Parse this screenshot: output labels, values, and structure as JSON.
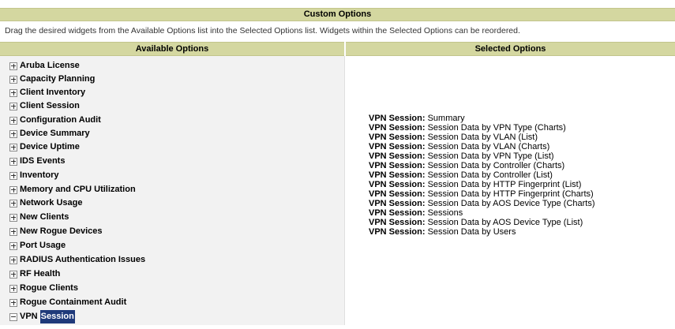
{
  "header": {
    "title": "Custom Options"
  },
  "instructions": "Drag the desired widgets from the Available Options list into the Selected Options list. Widgets within the Selected Options can be reordered.",
  "available": {
    "header": "Available Options",
    "items": [
      {
        "label": "Aruba License",
        "state": "collapsed"
      },
      {
        "label": "Capacity Planning",
        "state": "collapsed"
      },
      {
        "label": "Client Inventory",
        "state": "collapsed"
      },
      {
        "label": "Client Session",
        "state": "collapsed"
      },
      {
        "label": "Configuration Audit",
        "state": "collapsed"
      },
      {
        "label": "Device Summary",
        "state": "collapsed"
      },
      {
        "label": "Device Uptime",
        "state": "collapsed"
      },
      {
        "label": "IDS Events",
        "state": "collapsed"
      },
      {
        "label": "Inventory",
        "state": "collapsed"
      },
      {
        "label": "Memory and CPU Utilization",
        "state": "collapsed"
      },
      {
        "label": "Network Usage",
        "state": "collapsed"
      },
      {
        "label": "New Clients",
        "state": "collapsed"
      },
      {
        "label": "New Rogue Devices",
        "state": "collapsed"
      },
      {
        "label": "Port Usage",
        "state": "collapsed"
      },
      {
        "label": "RADIUS Authentication Issues",
        "state": "collapsed"
      },
      {
        "label": "RF Health",
        "state": "collapsed"
      },
      {
        "label": "Rogue Clients",
        "state": "collapsed"
      },
      {
        "label": "Rogue Containment Audit",
        "state": "collapsed"
      },
      {
        "label_prefix": "VPN",
        "label_selected": "Session",
        "state": "expanded"
      }
    ]
  },
  "selected": {
    "header": "Selected Options",
    "prefix": "VPN Session:",
    "items": [
      " Summary",
      " Session Data by VPN Type (Charts)",
      " Session Data by VLAN (List)",
      " Session Data by VLAN (Charts)",
      " Session Data by VPN Type (List)",
      " Session Data by Controller (Charts)",
      " Session Data by Controller (List)",
      " Session Data by HTTP Fingerprint (List)",
      " Session Data by HTTP Fingerprint (Charts)",
      " Session Data by AOS Device Type (Charts)",
      " Sessions",
      " Session Data by AOS Device Type (List)",
      " Session Data by Users"
    ]
  }
}
